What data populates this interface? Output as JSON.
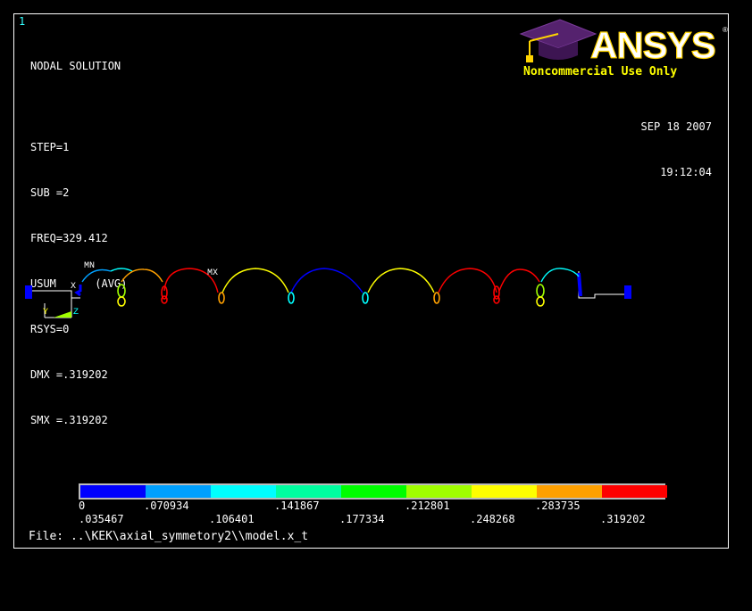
{
  "window_number": "1",
  "info_title": "NODAL SOLUTION",
  "info_lines": [
    "STEP=1",
    "SUB =2",
    "FREQ=329.412",
    "USUM      (AVG)",
    "RSYS=0",
    "DMX =.319202",
    "SMX =.319202"
  ],
  "brand": {
    "name": "ANSYS",
    "notice": "Noncommercial Use Only",
    "logo_color": "#55226e",
    "accent": "#ffff00"
  },
  "date": "SEP 18 2007",
  "time": "19:12:04",
  "markers": {
    "min": "MN",
    "max": "MX"
  },
  "axis_triad": {
    "x": "X",
    "y": "Y",
    "z": "Z"
  },
  "legend": {
    "colors": [
      "#0000ff",
      "#00a0ff",
      "#00ffff",
      "#00ffa0",
      "#00ff00",
      "#a0ff00",
      "#ffff00",
      "#ffa000",
      "#ff0000"
    ],
    "labels_top": [
      "0",
      ".070934",
      ".141867",
      ".212801",
      ".283735"
    ],
    "labels_bottom": [
      ".035467",
      ".106401",
      ".177334",
      ".248268",
      ".319202"
    ]
  },
  "file_line": "File: ..\\KEK\\axial_symmetory2\\\\model.x_t"
}
